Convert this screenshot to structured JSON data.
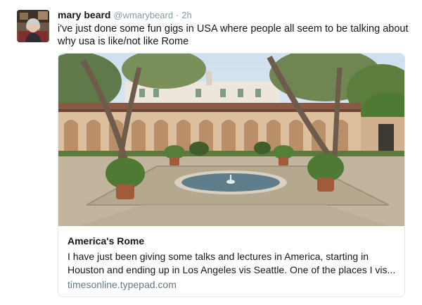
{
  "tweet": {
    "author_name": "mary beard",
    "author_handle": "@wmarybeard",
    "separator": "·",
    "time": "2h",
    "text": "i've just done some fun gigs in USA where people all seem to be talking about why usa is like/not like Rome"
  },
  "card": {
    "title": "America's Rome",
    "description": "I have just been giving some talks and lectures in America, starting in Houston and ending up in Los Angeles vis Seattle. One of the places I vis...",
    "domain": "timesonline.typepad.com"
  },
  "colors": {
    "name": "#14171a",
    "muted": "#8899a6",
    "domain": "#657786",
    "card_border": "#e1e8ed"
  }
}
